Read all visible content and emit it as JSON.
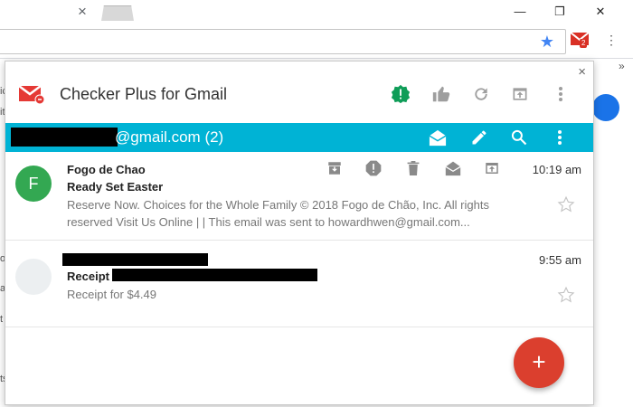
{
  "browser": {
    "tab_close_glyph": "×",
    "win_minimize": "—",
    "win_restore": "❐",
    "win_close": "✕",
    "ext_badge": "2",
    "bookmarks_chevron": "»",
    "bg_fragments": [
      "ic",
      "ito",
      "o",
      "at",
      "t",
      "ts"
    ]
  },
  "popup": {
    "title": "Checker Plus for Gmail",
    "close_glyph": "×",
    "account": {
      "email_suffix": "@gmail.com (2)"
    },
    "emails": [
      {
        "avatar_letter": "F",
        "avatar_color": "#33a852",
        "sender": "Fogo de Chao",
        "subject": "Ready Set Easter",
        "snippet_line1": "Reserve Now. Choices for the Whole Family © 2018 Fogo de Chão, Inc. All rights",
        "snippet_line2": "reserved Visit Us Online | | This email was sent to howardhwen@gmail.com...",
        "time": "10:19 am"
      },
      {
        "avatar_letter": "",
        "avatar_color": "#eceff1",
        "sender": "",
        "subject": "Receipt",
        "snippet_line1": "Receipt for $4.49",
        "time": "9:55 am"
      }
    ],
    "fab_glyph": "+"
  },
  "colors": {
    "accent": "#00b3d5",
    "fab": "#db3f2e",
    "gmail_red": "#d93025",
    "spam_green": "#0f9d58"
  },
  "icons": [
    "gmail-logo-icon",
    "spam-icon",
    "like-icon",
    "refresh-icon",
    "open-in-tab-icon",
    "more-vert-icon",
    "mark-read-icon",
    "compose-icon",
    "search-icon",
    "archive-icon",
    "delete-icon",
    "star-icon"
  ]
}
